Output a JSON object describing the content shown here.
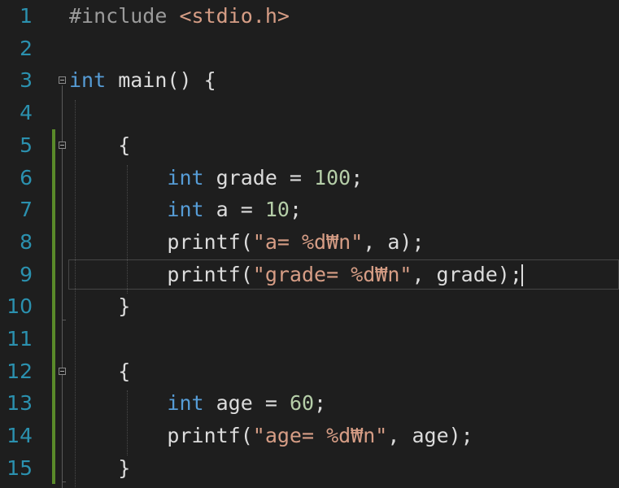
{
  "editor": {
    "lines": [
      {
        "number": "1",
        "tokens": [
          {
            "t": "#include ",
            "c": "pp"
          },
          {
            "t": "<stdio.h>",
            "c": "inc"
          }
        ]
      },
      {
        "number": "2",
        "tokens": []
      },
      {
        "number": "3",
        "tokens": [
          {
            "t": "int",
            "c": "kw"
          },
          {
            "t": " main() {",
            "c": "plain"
          }
        ]
      },
      {
        "number": "4",
        "tokens": []
      },
      {
        "number": "5",
        "tokens": [
          {
            "t": "    {",
            "c": "plain"
          }
        ]
      },
      {
        "number": "6",
        "tokens": [
          {
            "t": "        ",
            "c": "plain"
          },
          {
            "t": "int",
            "c": "kw"
          },
          {
            "t": " grade = ",
            "c": "plain"
          },
          {
            "t": "100",
            "c": "num"
          },
          {
            "t": ";",
            "c": "plain"
          }
        ]
      },
      {
        "number": "7",
        "tokens": [
          {
            "t": "        ",
            "c": "plain"
          },
          {
            "t": "int",
            "c": "kw"
          },
          {
            "t": " a = ",
            "c": "plain"
          },
          {
            "t": "10",
            "c": "num"
          },
          {
            "t": ";",
            "c": "plain"
          }
        ]
      },
      {
        "number": "8",
        "tokens": [
          {
            "t": "        printf(",
            "c": "plain"
          },
          {
            "t": "\"a= %d₩n\"",
            "c": "str"
          },
          {
            "t": ", a);",
            "c": "plain"
          }
        ]
      },
      {
        "number": "9",
        "tokens": [
          {
            "t": "        printf(",
            "c": "plain"
          },
          {
            "t": "\"grade= %d₩n\"",
            "c": "str"
          },
          {
            "t": ", grade);",
            "c": "plain"
          }
        ]
      },
      {
        "number": "10",
        "tokens": [
          {
            "t": "    }",
            "c": "plain"
          }
        ]
      },
      {
        "number": "11",
        "tokens": []
      },
      {
        "number": "12",
        "tokens": [
          {
            "t": "    {",
            "c": "plain"
          }
        ]
      },
      {
        "number": "13",
        "tokens": [
          {
            "t": "        ",
            "c": "plain"
          },
          {
            "t": "int",
            "c": "kw"
          },
          {
            "t": " age = ",
            "c": "plain"
          },
          {
            "t": "60",
            "c": "num"
          },
          {
            "t": ";",
            "c": "plain"
          }
        ]
      },
      {
        "number": "14",
        "tokens": [
          {
            "t": "        printf(",
            "c": "plain"
          },
          {
            "t": "\"age= %d₩n\"",
            "c": "str"
          },
          {
            "t": ", age);",
            "c": "plain"
          }
        ]
      },
      {
        "number": "15",
        "tokens": [
          {
            "t": "    }",
            "c": "plain"
          }
        ]
      }
    ],
    "current_line": "9",
    "fold_markers": [
      "3",
      "5",
      "12"
    ],
    "colors": {
      "background": "#1e1e1e",
      "line_number": "#2b91af",
      "keyword": "#569cd6",
      "preprocessor": "#9b9b9b",
      "string": "#d69d85",
      "number": "#b5cea8",
      "text": "#dcdcdc",
      "change_bar": "#5a8a2a"
    }
  }
}
